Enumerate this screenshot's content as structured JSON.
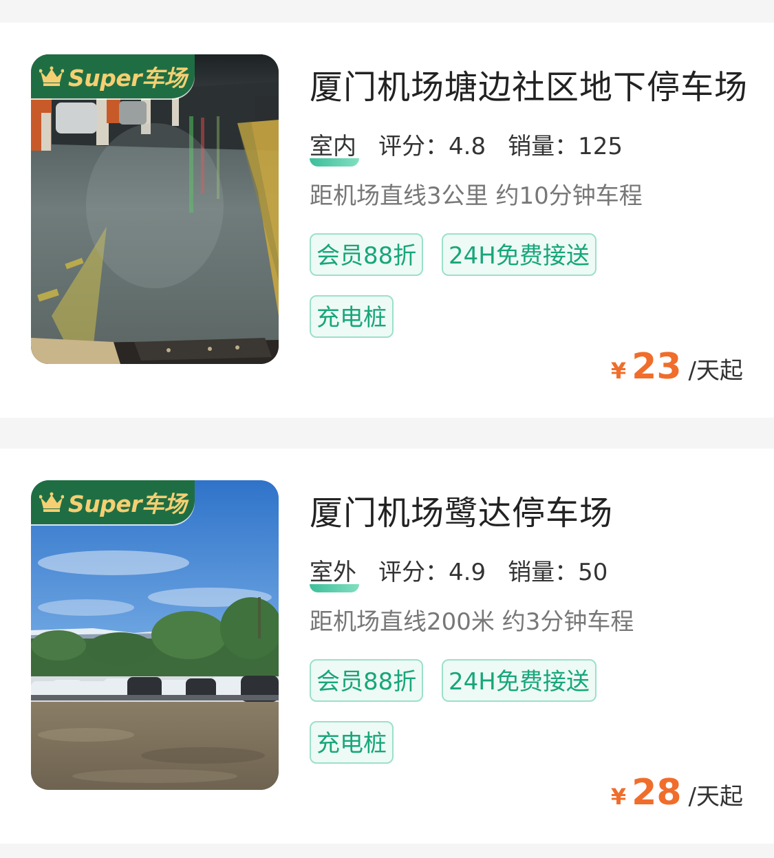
{
  "listings": [
    {
      "badge": "Super车场",
      "title": "厦门机场塘边社区地下停车场",
      "environment": "室内",
      "rating_label": "评分：",
      "rating": "4.8",
      "sales_label": "销量：",
      "sales": "125",
      "distance": "距机场直线3公里 约10分钟车程",
      "tags": [
        "会员88折",
        "24H免费接送",
        "充电桩"
      ],
      "currency": "¥",
      "price": "23",
      "price_unit": "/天起"
    },
    {
      "badge": "Super车场",
      "title": "厦门机场鹭达停车场",
      "environment": "室外",
      "rating_label": "评分：",
      "rating": "4.9",
      "sales_label": "销量：",
      "sales": "50",
      "distance": "距机场直线200米 约3分钟车程",
      "tags": [
        "会员88折",
        "24H免费接送",
        "充电桩"
      ],
      "currency": "¥",
      "price": "28",
      "price_unit": "/天起"
    }
  ],
  "colors": {
    "badge_bg": "#1f6e43",
    "badge_text": "#f5cf72",
    "tag_text": "#17a67a",
    "tag_border": "#9be0c8",
    "price": "#f06d2b"
  },
  "icons": {
    "crown": "crown-icon"
  }
}
